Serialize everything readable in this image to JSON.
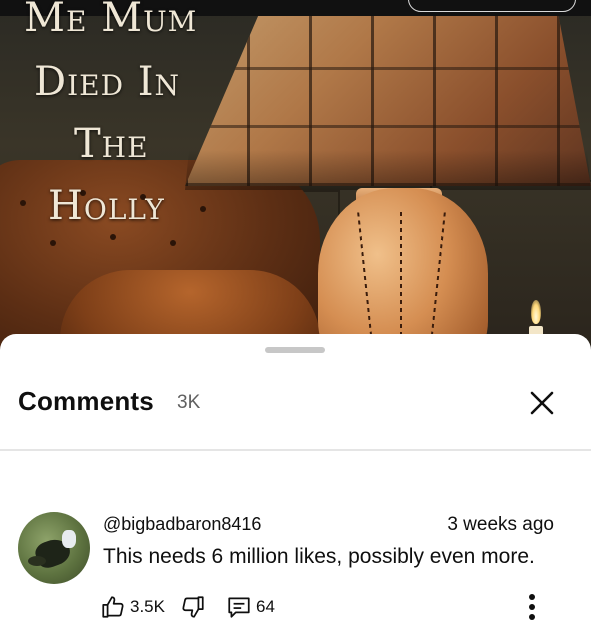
{
  "video": {
    "cover_title_lines": [
      "Me Mum",
      "Died In",
      "The",
      "Holly"
    ]
  },
  "comments_panel": {
    "title": "Comments",
    "count": "3K",
    "close_icon": "close-icon"
  },
  "comments": [
    {
      "author": "@bigbadbaron8416",
      "time": "3 weeks ago",
      "text": "This needs 6 million likes, possibly even more.",
      "likes": "3.5K",
      "replies": "64",
      "icons": [
        "thumbs-up-icon",
        "thumbs-down-icon",
        "reply-icon",
        "more-vert-icon"
      ]
    }
  ]
}
